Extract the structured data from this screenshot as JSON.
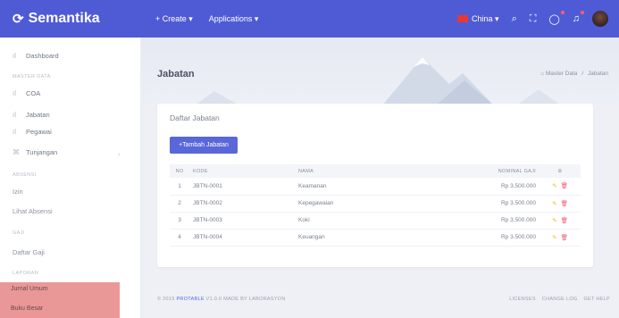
{
  "brand": {
    "name": "Semantika",
    "logo_icon": "refresh-logo-icon"
  },
  "topnav": {
    "create": "+ Create ▾",
    "applications": "Applications ▾"
  },
  "topright": {
    "language": "China ▾"
  },
  "sidebar": {
    "dashboard": "Dashboard",
    "section_master": "MASTER DATA",
    "coa": "COA",
    "jabatan": "Jabatan",
    "pegawai": "Pegawai",
    "tunjangan": "Tunjangan",
    "section_absensi": "ABSENSI",
    "izin": "Izin",
    "lihat_absensi": "Lihat Absensi",
    "section_gaji": "GAJI",
    "daftar_gaji": "Daftar Gaji",
    "section_laporan": "LAPORAN",
    "jurnal_umum": "Jurnal Umum",
    "buku_besar": "Buku Besar"
  },
  "header": {
    "title": "Jabatan",
    "breadcrumb_root": "Master Data",
    "breadcrumb_sep": "/",
    "breadcrumb_current": "Jabatan"
  },
  "card": {
    "title": "Daftar Jabatan",
    "add_button": "+Tambah Jabatan"
  },
  "table": {
    "headers": {
      "no": "NO",
      "kode": "KODE",
      "nama": "NAMA",
      "gaji": "NOMINAL GAJI",
      "action": "⚙"
    },
    "rows": [
      {
        "no": "1",
        "kode": "JBTN-0001",
        "nama": "Keamanan",
        "gaji": "Rp 3.500.000"
      },
      {
        "no": "2",
        "kode": "JBTN-0002",
        "nama": "Kepegawaian",
        "gaji": "Rp 3.500.000"
      },
      {
        "no": "3",
        "kode": "JBTN-0003",
        "nama": "Koki",
        "gaji": "Rp 3.500.000"
      },
      {
        "no": "4",
        "kode": "JBTN-0004",
        "nama": "Keuangan",
        "gaji": "Rp 3.500.000"
      }
    ]
  },
  "footer": {
    "copyright_prefix": "© 2019 ",
    "copyright_brand": "PROTABLE",
    "copyright_suffix": " V1.0.0 MADE BY LABORASYON",
    "licenses": "LICENSES",
    "changelog": "CHANGE LOG",
    "help": "GET HELP"
  },
  "colors": {
    "accent": "#4f5bd5",
    "button": "#5a67d8",
    "highlight": "#e98f8f"
  }
}
